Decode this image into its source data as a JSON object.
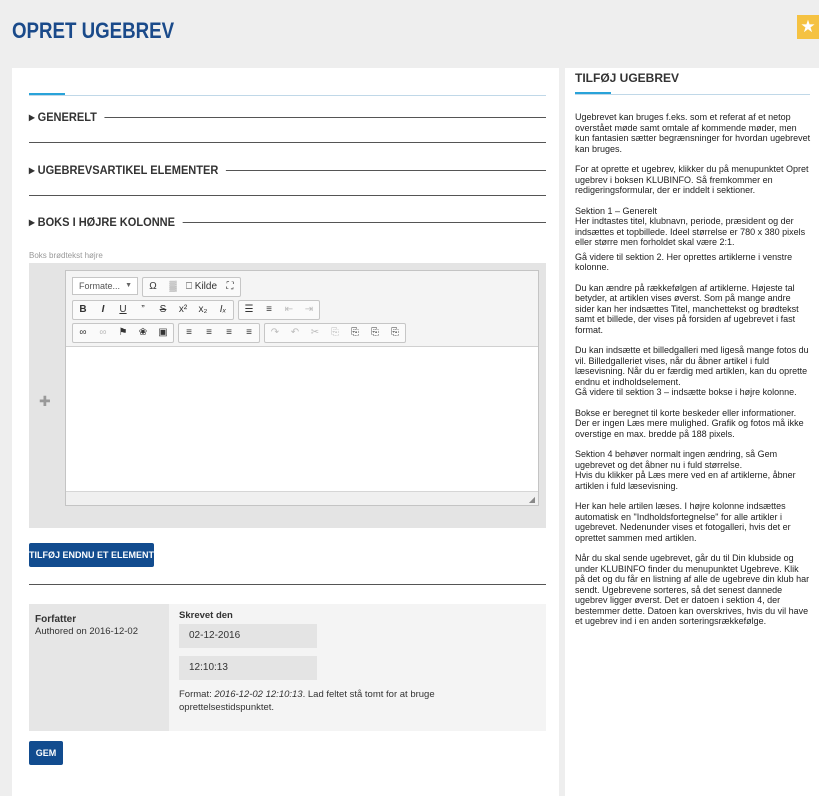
{
  "page": {
    "title": "OPRET UGEBREV"
  },
  "sections": {
    "general": "▸ GENERELT",
    "articles": "▸ UGEBREVSARTIKEL ELEMENTER",
    "box": "▸ BOKS I HØJRE KOLONNE"
  },
  "field": {
    "label": "Boks brødtekst højre"
  },
  "editor": {
    "format_placeholder": "Formate...",
    "source_label": "Kilde",
    "row1": [
      "Ω",
      "▓",
      "⎕ Kilde",
      "⛶"
    ],
    "row2a": [
      "B",
      "I",
      "U",
      "”",
      "S",
      "x²",
      "x₂",
      "Iₓ"
    ],
    "row2b": [
      "☰",
      "≡",
      "⇤",
      "⇥"
    ],
    "row3a": [
      "∞",
      "∞",
      "⚑",
      "❀",
      "▣"
    ],
    "row3b": [
      "≡",
      "≡",
      "≡",
      "≡"
    ],
    "row3c": [
      "↷",
      "↶",
      "✂",
      "⎘",
      "⎘",
      "⎘",
      "⎘"
    ]
  },
  "buttons": {
    "add_element": "TILFØJ ENDNU ET ELEMENT",
    "save": "GEM"
  },
  "author": {
    "title": "Forfatter",
    "authored_on": "Authored on 2016-12-02",
    "written_title": "Skrevet den",
    "date": "02-12-2016",
    "time": "12:10:13",
    "help_prefix": "Format: ",
    "help_example": "2016-12-02 12:10:13",
    "help_suffix": ". Lad feltet stå tomt for at bruge oprettelsestidspunktet."
  },
  "sidebar": {
    "title": "TILFØJ UGEBREV",
    "paragraphs": [
      "Ugebrevet kan bruges f.eks. som et referat af et netop overstået møde samt omtale af kommende møder, men kun fantasien sætter begrænsninger for hvordan ugebrevet kan bruges.",
      "For at oprette et ugebrev, klikker du på menupunktet Opret ugebrev i boksen KLUBINFO. Så fremkommer en redigeringsformular, der er inddelt i sektioner.",
      "Sektion 1 – Generelt\nHer indtastes titel, klubnavn, periode, præsident og der indsættes et topbillede. Ideel størrelse er 780 x 380 pixels eller større men forholdet skal være 2:1.",
      "Gå videre til sektion 2. Her oprettes artiklerne i venstre kolonne.",
      "Du kan ændre på rækkefølgen af artiklerne. Højeste tal betyder, at artiklen vises øverst. Som på mange andre sider kan her indsættes Titel, manchettekst og brødtekst samt et billede, der vises på forsiden af ugebrevet i fast format.",
      "Du kan indsætte et billedgalleri med ligeså mange fotos du vil. Billedgalleriet vises, når du åbner artikel i fuld læsevisning. Når du er færdig med artiklen, kan du oprette endnu et indholdselement.\nGå videre til sektion 3 – indsætte bokse i højre kolonne.",
      "Bokse er beregnet til korte beskeder eller informationer. Der er ingen Læs mere mulighed. Grafik og fotos må ikke overstige en max. bredde på 188 pixels.",
      "Sektion 4 behøver normalt ingen ændring, så Gem ugebrevet og det åbner nu i fuld størrelse.\nHvis du klikker på Læs mere ved en af artiklerne, åbner artiklen i fuld læsevisning.",
      "Her kan hele artilen læses. I højre kolonne indsættes automatisk en \"Indholdsfortegnelse\" for alle artikler i ugebrevet. Nedenunder vises et fotogalleri, hvis det er oprettet sammen med artiklen.",
      "Når du skal sende ugebrevet, går du til Din klubside og under KLUBINFO finder du menupunktet Ugebreve. Klik på det og du får en listning af alle de ugebreve din klub har sendt. Ugebrevene sorteres, så det senest dannede ugebrev ligger øverst. Det er datoen i sektion 4, der bestemmer dette. Datoen kan overskrives, hvis du vil have et ugebrev ind i en anden sorteringsrækkefølge."
    ]
  },
  "colors": {
    "brand": "#124c8f",
    "title": "#1a4a8a",
    "accent": "#29a3d9",
    "star": "#f5c242"
  },
  "icons": {
    "star": "star-icon",
    "drag": "drag-handle-icon",
    "resize": "resize-icon"
  }
}
